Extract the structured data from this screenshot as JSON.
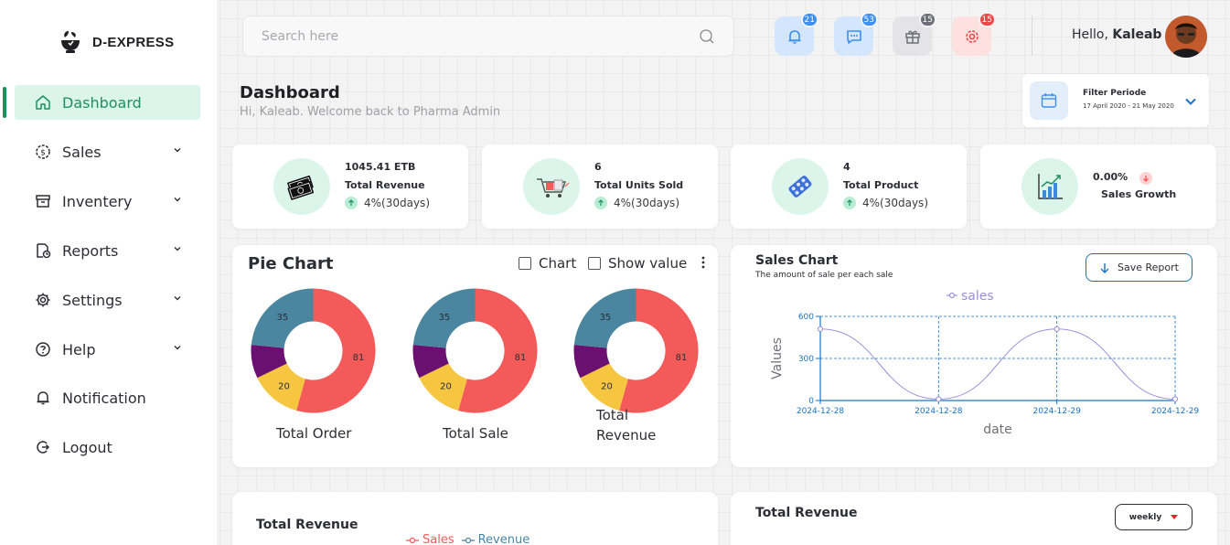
{
  "brand": {
    "name": "D-EXPRESS"
  },
  "sidebar": {
    "items": [
      {
        "label": "Dashboard",
        "icon": "home-icon",
        "active": true,
        "has_submenu": false
      },
      {
        "label": "Sales",
        "icon": "dollar-icon",
        "active": false,
        "has_submenu": true
      },
      {
        "label": "Inventery",
        "icon": "archive-icon",
        "active": false,
        "has_submenu": true
      },
      {
        "label": "Reports",
        "icon": "report-icon",
        "active": false,
        "has_submenu": true
      },
      {
        "label": "Settings",
        "icon": "gear-icon",
        "active": false,
        "has_submenu": true
      },
      {
        "label": "Help",
        "icon": "help-icon",
        "active": false,
        "has_submenu": true
      },
      {
        "label": "Notification",
        "icon": "bell-icon",
        "active": false,
        "has_submenu": false
      },
      {
        "label": "Logout",
        "icon": "logout-icon",
        "active": false,
        "has_submenu": false
      }
    ]
  },
  "header": {
    "search_placeholder": "Search here",
    "icons": [
      {
        "name": "bell-icon",
        "badge": "21",
        "color": "#3d8ff0",
        "bg": "#d3e6fb",
        "badge_color": "#3d8ff0"
      },
      {
        "name": "message-icon",
        "badge": "53",
        "color": "#3d8ff0",
        "bg": "#d3e6fb",
        "badge_color": "#3d8ff0"
      },
      {
        "name": "gift-icon",
        "badge": "15",
        "color": "#6f6f78",
        "bg": "#e4e4e8",
        "badge_color": "#6f6f78"
      },
      {
        "name": "settings-icon",
        "badge": "15",
        "color": "#f04848",
        "bg": "#fde0e0",
        "badge_color": "#f04848"
      }
    ],
    "greeting": "Hello,",
    "user_name": "Kaleab"
  },
  "page": {
    "title": "Dashboard",
    "subtitle": "Hi, Kaleab. Welcome back to Pharma Admin"
  },
  "filter": {
    "title": "Filter Periode",
    "range": "17 April 2020 - 21 May 2020"
  },
  "stats": [
    {
      "value": "1045.41 ETB",
      "label": "Total Revenue",
      "change": "4%(30days)",
      "trend": "up",
      "icon": "money-icon"
    },
    {
      "value": "6",
      "label": "Total Units Sold",
      "change": "4%(30days)",
      "trend": "up",
      "icon": "cart-icon"
    },
    {
      "value": "4",
      "label": "Total Product",
      "change": "4%(30days)",
      "trend": "up",
      "icon": "pills-icon"
    },
    {
      "value": "0.00%",
      "label": "Sales Growth",
      "change": "",
      "trend": "down",
      "icon": "growth-chart-icon"
    }
  ],
  "pie_card": {
    "title": "Pie Chart",
    "checkbox_chart": "Chart",
    "checkbox_show_value": "Show value",
    "donuts": [
      {
        "label": "Total Order"
      },
      {
        "label": "Total Sale"
      },
      {
        "label": "Total Revenue"
      }
    ]
  },
  "sales_card": {
    "title": "Sales Chart",
    "subtitle": "The amount of sale per each sale",
    "save_label": "Save Report"
  },
  "bottom": {
    "left_title": "Total Revenue",
    "left_legend": [
      "Sales",
      "Revenue"
    ],
    "right_title": "Total Revenue",
    "period_select": "weekly"
  },
  "colors": {
    "accent": "#1f8f5f",
    "accent_light": "#dcf5ea",
    "pie_red": "#f55a5a",
    "pie_teal": "#4a86a0",
    "pie_purple": "#6b1070",
    "pie_yellow": "#f6c640",
    "line": "#9b8fd6",
    "axis_blue": "#1a73c8"
  },
  "chart_data": [
    {
      "type": "pie",
      "title": "Total Order",
      "slices": [
        {
          "value": 81,
          "color": "#f55a5a"
        },
        {
          "value": 20,
          "color": "#f6c640"
        },
        {
          "value": 13,
          "color": "#6b1070"
        },
        {
          "value": 35,
          "color": "#4a86a0"
        }
      ]
    },
    {
      "type": "pie",
      "title": "Total Sale",
      "slices": [
        {
          "value": 81,
          "color": "#f55a5a"
        },
        {
          "value": 20,
          "color": "#f6c640"
        },
        {
          "value": 13,
          "color": "#6b1070"
        },
        {
          "value": 35,
          "color": "#4a86a0"
        }
      ]
    },
    {
      "type": "pie",
      "title": "Total Revenue",
      "slices": [
        {
          "value": 81,
          "color": "#f55a5a"
        },
        {
          "value": 20,
          "color": "#f6c640"
        },
        {
          "value": 13,
          "color": "#6b1070"
        },
        {
          "value": 35,
          "color": "#4a86a0"
        }
      ]
    },
    {
      "type": "line",
      "series": [
        {
          "name": "sales",
          "values": [
            510,
            10,
            510,
            10
          ]
        }
      ],
      "categories": [
        "2024-12-28",
        "2024-12-28",
        "2024-12-29",
        "2024-12-29"
      ],
      "xlabel": "date",
      "ylabel": "Values",
      "yticks": [
        0,
        300,
        600
      ],
      "ylim": [
        0,
        600
      ],
      "grid": true,
      "legend": "top"
    }
  ]
}
